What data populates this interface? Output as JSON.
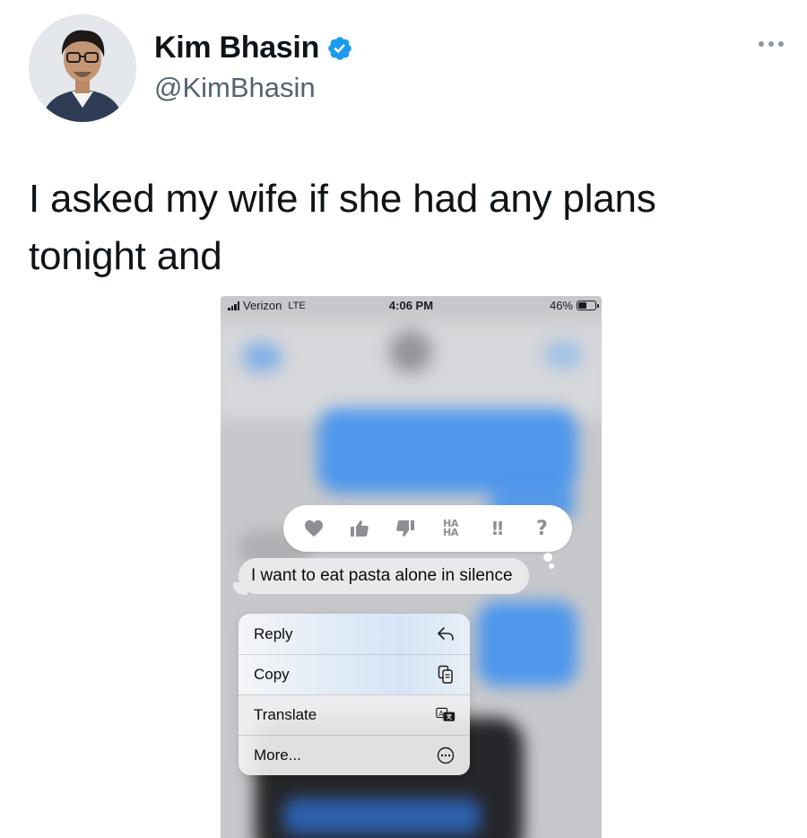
{
  "tweet": {
    "author": {
      "display_name": "Kim Bhasin",
      "handle": "@KimBhasin",
      "verified": true,
      "avatar_icon": "user-photo-avatar"
    },
    "text": "I asked my wife if she had any plans tonight and",
    "menu_icon": "more-dots-icon"
  },
  "colors": {
    "verified_blue": "#1d9bf0",
    "text_primary": "#0f1419",
    "text_secondary": "#536471",
    "imessage_blue": "#3b8ff1"
  },
  "phone": {
    "status_bar": {
      "carrier": "Verizon",
      "network": "LTE",
      "time": "4:06 PM",
      "battery": "46%"
    },
    "tapback": {
      "reactions": [
        {
          "name": "heart",
          "icon": "heart-icon"
        },
        {
          "name": "thumbs-up",
          "icon": "thumbs-up-icon"
        },
        {
          "name": "thumbs-down",
          "icon": "thumbs-down-icon"
        },
        {
          "name": "haha",
          "line1": "HA",
          "line2": "HA"
        },
        {
          "name": "emphasize",
          "glyph": "!!"
        },
        {
          "name": "question",
          "glyph": "?"
        }
      ]
    },
    "selected_message": "I want to eat pasta alone in silence",
    "context_menu": [
      {
        "label": "Reply",
        "icon": "reply-arrow-icon"
      },
      {
        "label": "Copy",
        "icon": "copy-icon"
      },
      {
        "label": "Translate",
        "icon": "translate-icon"
      },
      {
        "label": "More...",
        "icon": "more-circle-icon"
      }
    ]
  }
}
